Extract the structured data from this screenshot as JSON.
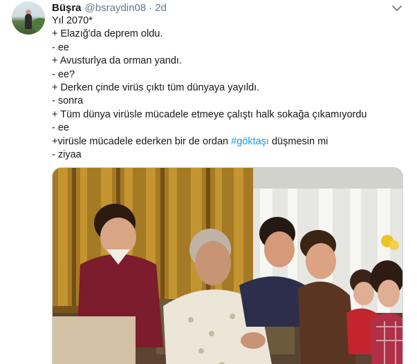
{
  "tweet": {
    "author_name": "Büşra",
    "author_handle": "@bsraydin08",
    "separator": "·",
    "time": "2d",
    "lines": [
      "Yıl 2070*",
      "+ Elazığ'da deprem oldu.",
      "- ee",
      "+ Avusturlya da orman yandı.",
      "- ee?",
      "+ Derken çinde virüs çıktı tüm dünyaya yayıldı.",
      "- sonra",
      "+ Tüm dünya virüsle mücadele etmeye çalıştı halk sokağa çıkamıyordu",
      "- ee"
    ],
    "line10_before": "+virüsle mücadele ederken bir de ordan ",
    "hashtag": "#göktaşı",
    "line10_after": " düşmesin mi",
    "line11": "- ziyaa"
  },
  "icons": {
    "menu": "chevron-down-icon"
  },
  "colors": {
    "text": "#14171a",
    "secondary": "#657786",
    "link": "#1b95e0"
  }
}
